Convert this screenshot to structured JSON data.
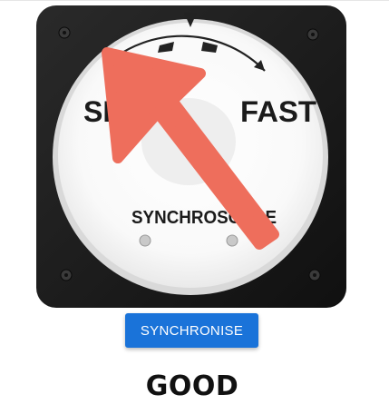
{
  "synchroscope": {
    "left_label": "SLOW",
    "right_label": "FAST",
    "name_label": "SYNCHROSCOPE",
    "pointer_color": "#ee6e5c",
    "bezel_color": "#1c1c1c",
    "face_color": "#ffffff"
  },
  "controls": {
    "sync_button_label": "SYNCHRONISE",
    "sync_button_color": "#1a73d9"
  },
  "status": {
    "text": "GOOD"
  }
}
